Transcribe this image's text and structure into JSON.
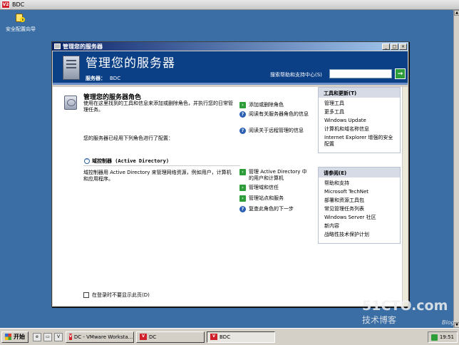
{
  "vm": {
    "logo": "V2",
    "title": "BDC"
  },
  "desktop": {
    "icon_label": "安全配置向导"
  },
  "window": {
    "title": "管理您的服务器",
    "controls": [
      "_",
      "□",
      "×"
    ]
  },
  "header": {
    "title": "管理您的服务器",
    "server_label": "服务器：",
    "server_name": "BDC",
    "search_label": "搜索帮助和支持中心(S)",
    "search_value": "",
    "go_label": "→"
  },
  "main": {
    "heading": "管理您的服务器角色",
    "description": "使用在这里找到的工具和信息来添加或删除角色，并执行您的日常管理任务。",
    "configured_text": "您的服务器已经用下列角色进行了配置：",
    "top_tasks": [
      {
        "label": "添加或删除角色",
        "icon": "arrow"
      },
      {
        "label": "阅读有关服务器角色的信息",
        "icon": "help"
      },
      {
        "label": "阅读关于远程管理的信息",
        "icon": "help"
      }
    ],
    "role": {
      "name": "域控制器 (Active Directory)",
      "description": "域控制器用 Active Directory 来管理网络资源，例如用户，计算机和应用程序。",
      "tasks": [
        {
          "label": "管理 Active Directory 中的用户和计算机",
          "icon": "arrow"
        },
        {
          "label": "管理域和信任",
          "icon": "arrow"
        },
        {
          "label": "管理站点和服务",
          "icon": "arrow"
        },
        {
          "label": "复查此角色的下一步",
          "icon": "help"
        }
      ]
    },
    "show_at_logon": "在登录时不要显示此页(D)"
  },
  "panels": {
    "tools": {
      "title": "工具和更新(T)",
      "items": [
        "管理工具",
        "更多工具",
        "Windows Update",
        "计算机和域名称信息",
        "Internet Explorer 增强的安全配置"
      ]
    },
    "see_also": {
      "title": "请参阅(E)",
      "items": [
        "帮助和支持",
        "Microsoft TechNet",
        "部署和资源工具包",
        "常见管理任务列表",
        "Windows Server 社区",
        "新内容",
        "战略性技术保护计划"
      ]
    }
  },
  "taskbar": {
    "start": "开始",
    "tasks": [
      {
        "label": "DC - VMware Worksta...",
        "active": false
      },
      {
        "label": "DC",
        "active": false
      },
      {
        "label": "BDC",
        "active": true
      }
    ],
    "clock": "19:51"
  },
  "watermark": {
    "line1": "51CTO.com",
    "line2": "技术博客",
    "line3": "Blog"
  }
}
